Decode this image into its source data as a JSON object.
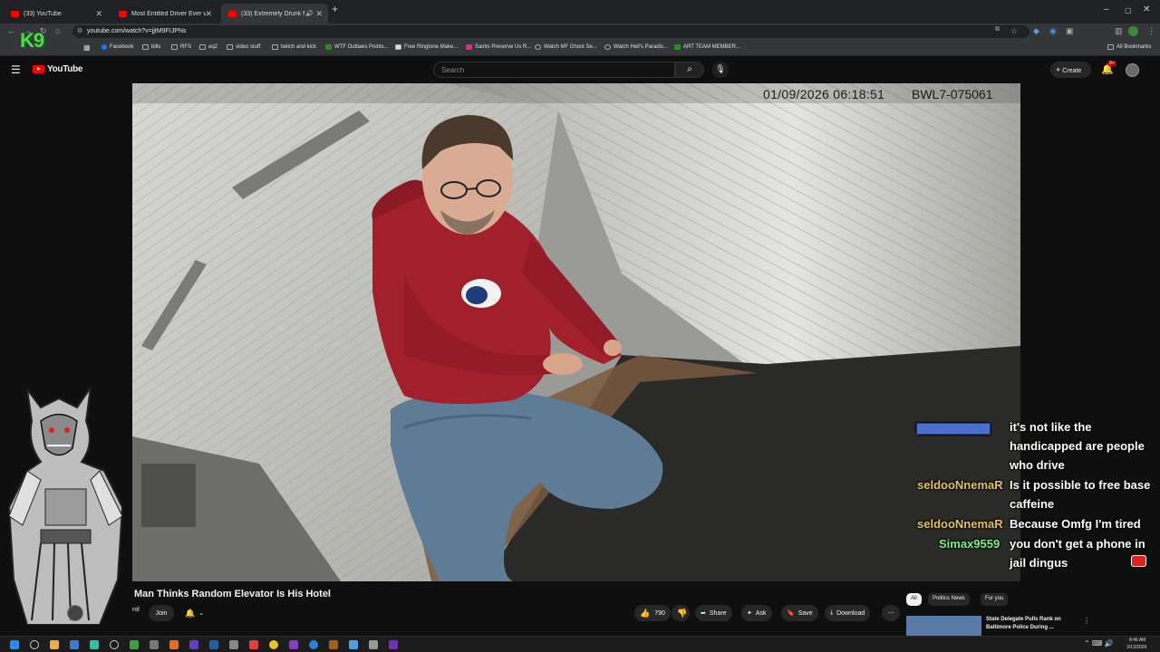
{
  "browser": {
    "tabs": [
      {
        "label": "(33) YouTube"
      },
      {
        "label": "Most Entitled Driver Ever vs Bo"
      },
      {
        "label": "(33) Extremely Drunk Man"
      }
    ],
    "url": "youtube.com/watch?v=jjtM9FIJPNs",
    "bookmarks": [
      "Facebook",
      "bills",
      "RFS",
      "eq2",
      "video stuff",
      "twitch and kick",
      "WTF Outlaws Points...",
      "Free Ringtone Make...",
      "Saints Preserve Us R...",
      "Watch MF Ghost Se...",
      "Watch Hell's Paradis...",
      "ART TEAM MEMBER..."
    ],
    "all_bookmarks": "All Bookmarks"
  },
  "youtube": {
    "logo_text": "YouTube",
    "search_placeholder": "Search",
    "create_label": "Create",
    "notif_count": "9+"
  },
  "video": {
    "timestamp": "01/09/2026 06:18:51",
    "camera_id": "BWL7-075061",
    "title": "Man Thinks Random Elevator Is His Hotel",
    "channel_short": "rol",
    "join_label": "Join",
    "likes": "790",
    "share_label": "Share",
    "ask_label": "Ask",
    "save_label": "Save",
    "download_label": "Download"
  },
  "overlay": {
    "logo": "K9"
  },
  "chat": [
    {
      "user": "",
      "text": "it's not like the"
    },
    {
      "user": "",
      "text": "handicapped are people"
    },
    {
      "user": "",
      "text": "who drive"
    },
    {
      "user": "seldooNnemaR",
      "text": "Is it possible to free base"
    },
    {
      "user": "",
      "text": "caffeine"
    },
    {
      "user": "seldooNnemaR",
      "text": "Because Omfg I'm tired"
    },
    {
      "user": "Simax9559",
      "text": "you don't get a phone in"
    },
    {
      "user": "",
      "text": "jail dingus"
    }
  ],
  "chat_colors": {
    "user1": "#e6c15a",
    "user2": "#7df07d"
  },
  "sidebar": {
    "chips": [
      "All",
      "Politics News",
      "For you"
    ],
    "rec_title_1": "State Delegate Pulls Rank on",
    "rec_title_2": "Baltimore Police During ..."
  },
  "clock": {
    "time": "8:46 AM",
    "date": "3/13/2026"
  }
}
